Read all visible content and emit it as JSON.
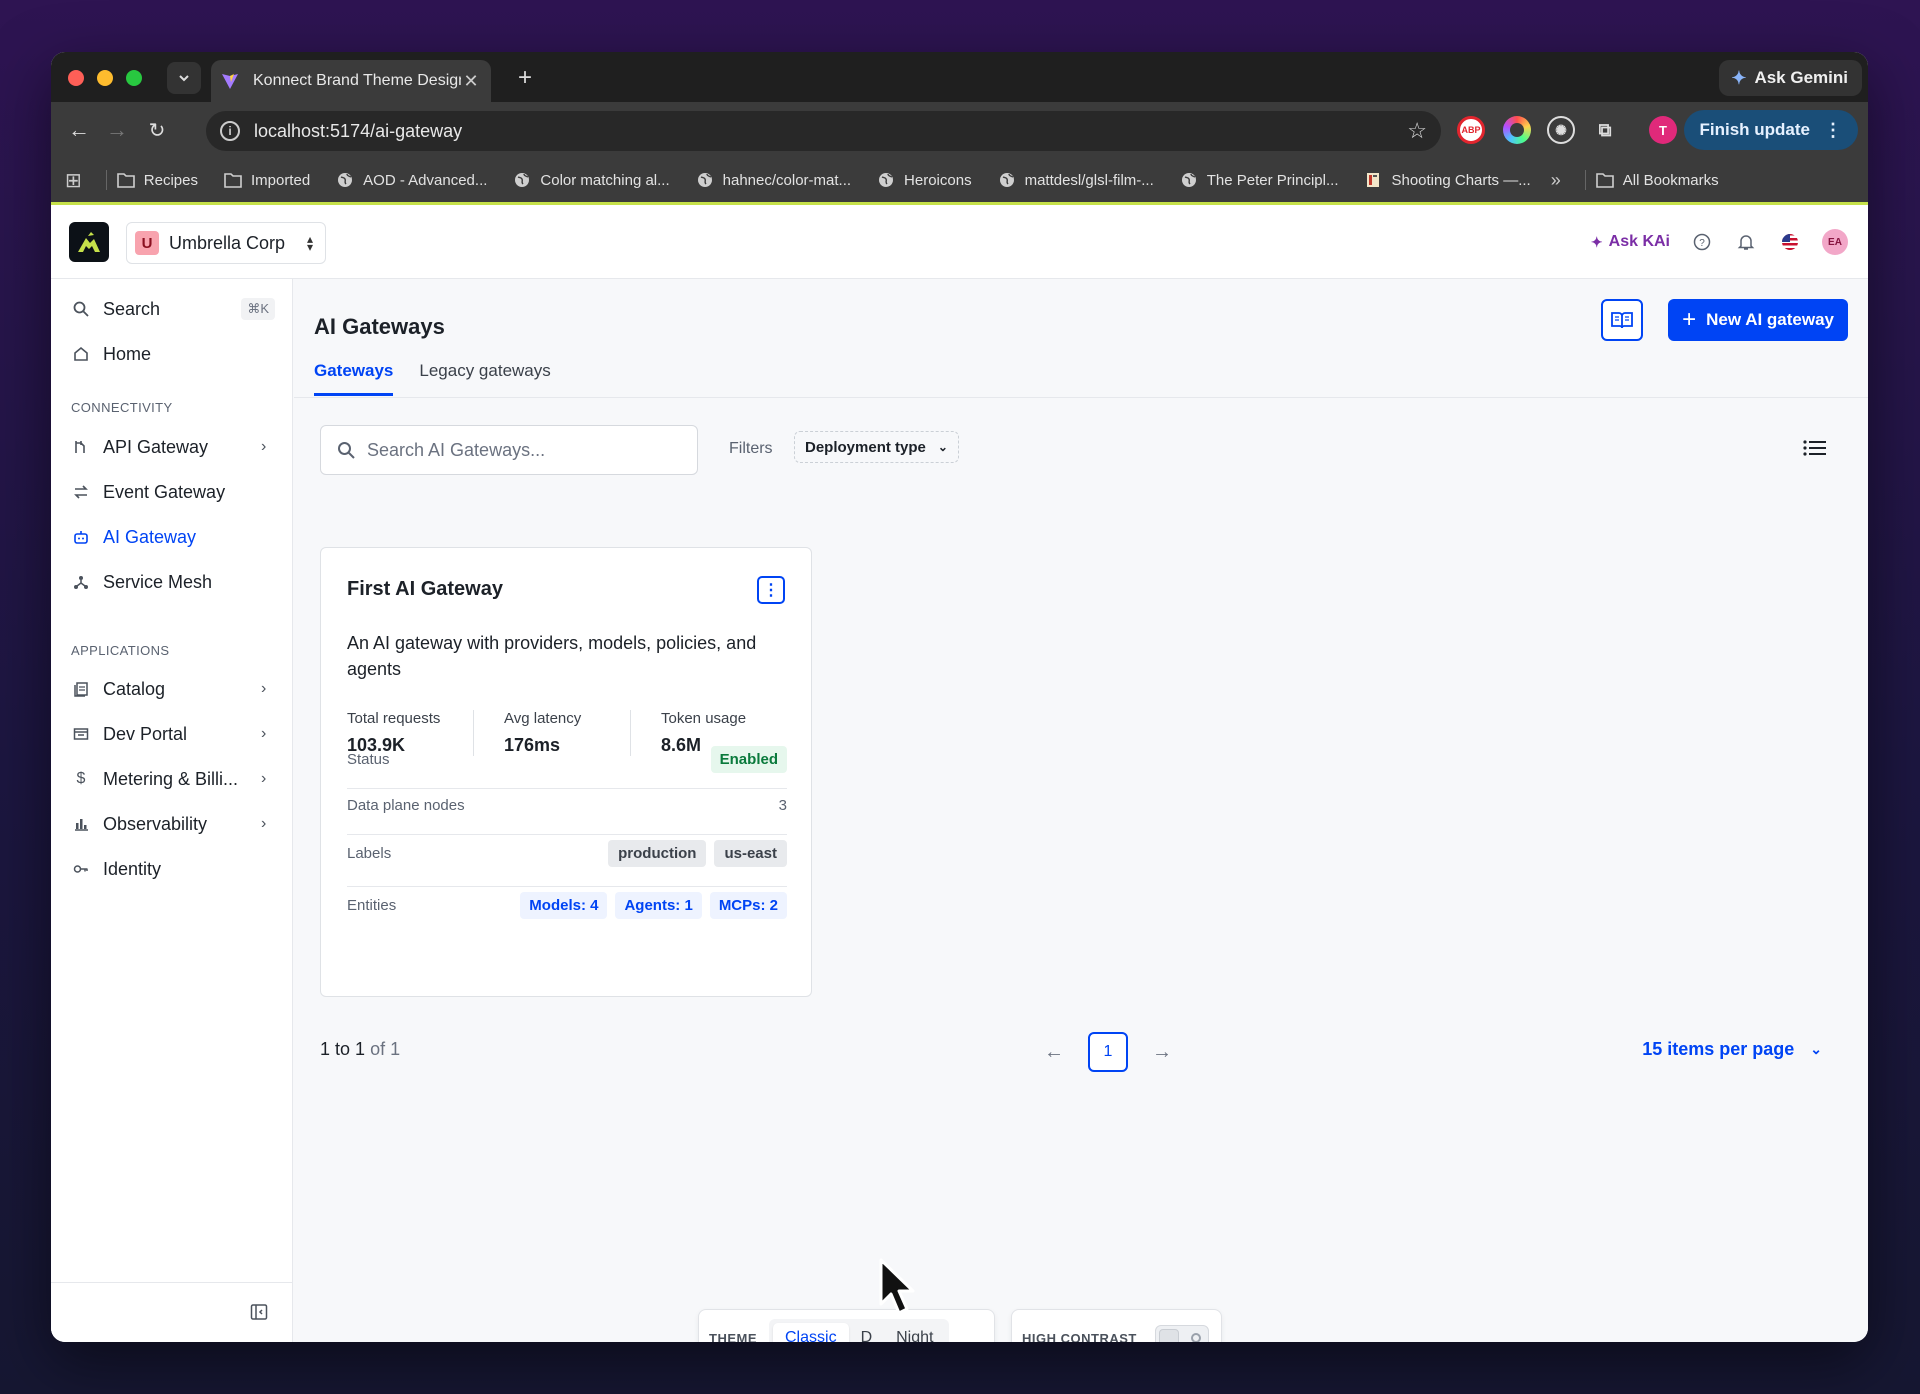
{
  "browser": {
    "tab_title": "Konnect Brand Theme Design",
    "ask_gemini": "Ask Gemini",
    "url": "localhost:5174/ai-gateway",
    "profile_initial": "T",
    "finish_update": "Finish update",
    "ext_abp": "ABP",
    "bookmarks": [
      {
        "label": "Recipes",
        "icon": "folder-icon"
      },
      {
        "label": "Imported",
        "icon": "folder-icon"
      },
      {
        "label": "AOD - Advanced...",
        "icon": "globe-icon"
      },
      {
        "label": "Color matching al...",
        "icon": "globe-icon"
      },
      {
        "label": "hahnec/color-mat...",
        "icon": "globe-icon"
      },
      {
        "label": "Heroicons",
        "icon": "globe-icon"
      },
      {
        "label": "mattdesl/glsl-film-...",
        "icon": "globe-icon"
      },
      {
        "label": "The Peter Principl...",
        "icon": "globe-icon"
      },
      {
        "label": "Shooting Charts —...",
        "icon": "page-icon"
      }
    ],
    "all_bookmarks": "All Bookmarks"
  },
  "header": {
    "org_initial": "U",
    "org_name": "Umbrella Corp",
    "ask_kai": "Ask KAi",
    "avatar_initials": "EA"
  },
  "sidebar": {
    "search_label": "Search",
    "search_shortcut": "⌘K",
    "home": "Home",
    "section_connectivity": "CONNECTIVITY",
    "section_applications": "APPLICATIONS",
    "items": {
      "api_gateway": "API Gateway",
      "event_gateway": "Event Gateway",
      "ai_gateway": "AI Gateway",
      "service_mesh": "Service Mesh",
      "catalog": "Catalog",
      "dev_portal": "Dev Portal",
      "metering": "Metering & Billi...",
      "observability": "Observability",
      "identity": "Identity"
    }
  },
  "main": {
    "title": "AI Gateways",
    "new_button": "New AI gateway",
    "tabs": [
      "Gateways",
      "Legacy gateways"
    ],
    "search_placeholder": "Search AI Gateways...",
    "filters_label": "Filters",
    "filter_value": "Deployment type",
    "card": {
      "title": "First AI Gateway",
      "description": "An AI gateway with providers, models, policies, and agents",
      "metrics": [
        {
          "label": "Total requests",
          "value": "103.9K"
        },
        {
          "label": "Avg latency",
          "value": "176ms"
        },
        {
          "label": "Token usage",
          "value": "8.6M"
        }
      ],
      "status_label": "Status",
      "status_value": "Enabled",
      "nodes_label": "Data plane nodes",
      "nodes_value": "3",
      "labels_label": "Labels",
      "labels": [
        "production",
        "us-east"
      ],
      "entities_label": "Entities",
      "entities": [
        "Models: 4",
        "Agents: 1",
        "MCPs: 2"
      ]
    },
    "pagination": {
      "range": "1 to 1",
      "of": "of 1",
      "page": "1",
      "per_page": "15 items per page"
    }
  },
  "theme_panel": {
    "label": "THEME",
    "options": [
      "Classic",
      "D",
      "Night"
    ],
    "selected": "Classic",
    "hc_label": "HIGH CONTRAST",
    "hc_on": false
  },
  "colors": {
    "brand_blue": "#0044f4",
    "accent_lime": "#c6e14a",
    "enabled_green": "#0a7a3c",
    "kai_purple": "#7b2ea6"
  }
}
